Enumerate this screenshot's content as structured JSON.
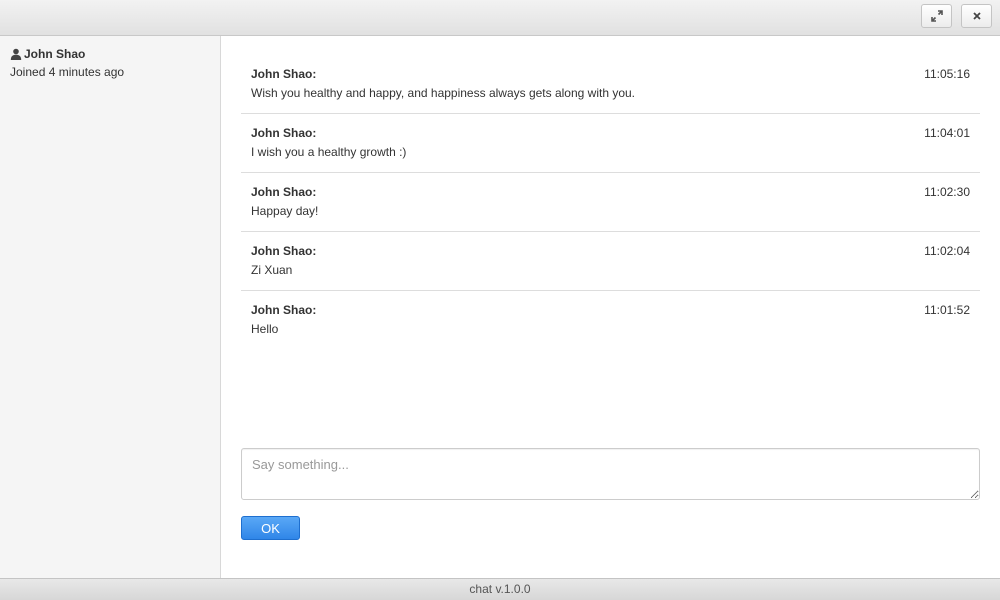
{
  "window_controls": {
    "expand_icon": "expand-arrows-icon",
    "close_icon": "close-x-icon"
  },
  "sidebar": {
    "users": [
      {
        "icon": "user-icon",
        "name": "John Shao",
        "status": "Joined 4 minutes ago"
      }
    ]
  },
  "messages": [
    {
      "author": "John Shao:",
      "time": "11:05:16",
      "text": "Wish you healthy and happy, and happiness always gets along with you."
    },
    {
      "author": "John Shao:",
      "time": "11:04:01",
      "text": "I wish you a healthy growth :)"
    },
    {
      "author": "John Shao:",
      "time": "11:02:30",
      "text": "Happay day!"
    },
    {
      "author": "John Shao:",
      "time": "11:02:04",
      "text": "Zi Xuan"
    },
    {
      "author": "John Shao:",
      "time": "11:01:52",
      "text": "Hello"
    }
  ],
  "composer": {
    "placeholder": "Say something...",
    "value": "",
    "submit_label": "OK"
  },
  "footer": {
    "version": "chat v.1.0.0"
  },
  "colors": {
    "accent": "#2f86e8",
    "sidebar_bg": "#f5f5f5",
    "divider": "#dddddd"
  }
}
